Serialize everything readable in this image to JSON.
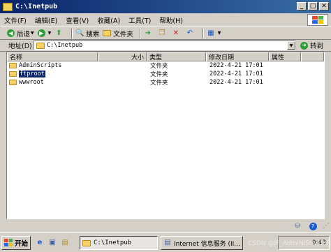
{
  "window": {
    "title": "C:\\Inetpub"
  },
  "menu": [
    "文件(F)",
    "编辑(E)",
    "查看(V)",
    "收藏(A)",
    "工具(T)",
    "帮助(H)"
  ],
  "toolbar": {
    "back": "后退",
    "search": "搜索",
    "folders": "文件夹"
  },
  "address": {
    "label": "地址(D)",
    "path": "C:\\Inetpub",
    "go": "转到"
  },
  "columns": {
    "name": "名称",
    "size": "大小",
    "type": "类型",
    "modified": "修改日期",
    "attributes": "属性"
  },
  "files": [
    {
      "name": "AdminScripts",
      "type": "文件夹",
      "modified": "2022-4-21 17:01",
      "selected": false
    },
    {
      "name": "ftproot",
      "type": "文件夹",
      "modified": "2022-4-21 17:01",
      "selected": true
    },
    {
      "name": "wwwroot",
      "type": "文件夹",
      "modified": "2022-4-21 17:01",
      "selected": false
    }
  ],
  "taskbar": {
    "start": "开始",
    "tasks": [
      "C:\\Inetpub",
      "Internet 信息服务 (II..."
    ],
    "clock": "9:43"
  },
  "watermark": "CSDN @JF_AdmiNiStRaToR"
}
